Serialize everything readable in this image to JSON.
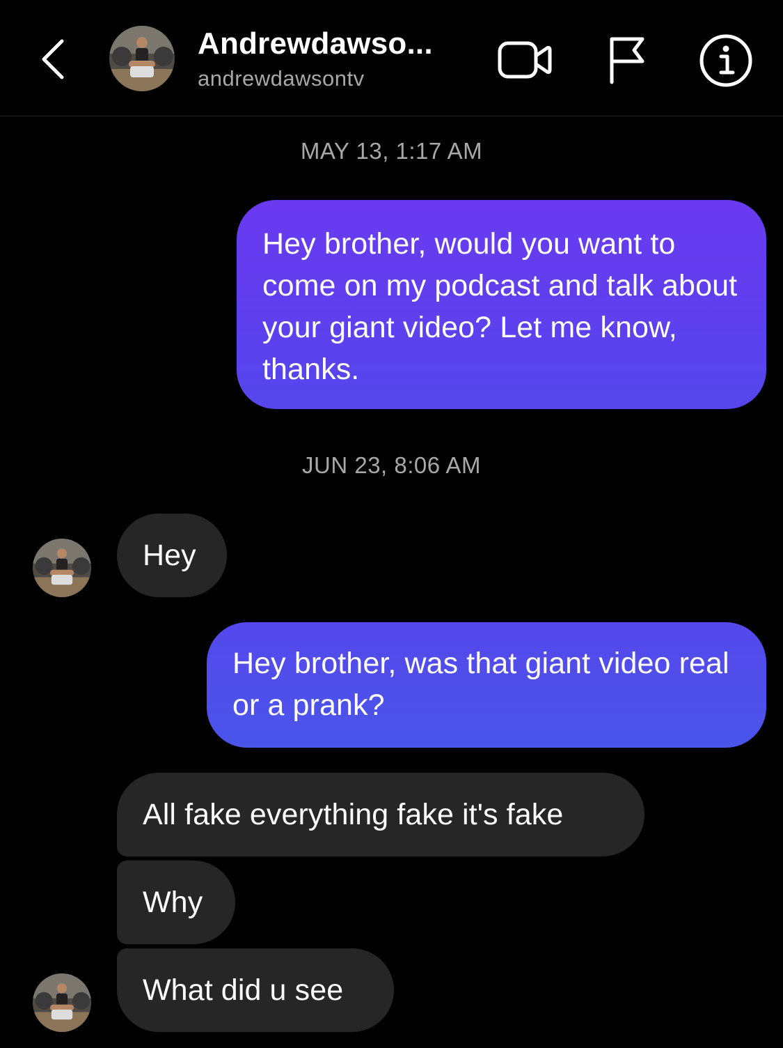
{
  "header": {
    "title": "Andrewdawso...",
    "handle": "andrewdawsontv",
    "icons": {
      "back": "chevron-left-icon",
      "video": "video-camera-icon",
      "flag": "flag-icon",
      "info": "info-icon"
    }
  },
  "messages": {
    "timestamp_1": "MAY 13, 1:17 AM",
    "sent_1": "Hey brother, would you want to come on my podcast and talk about your giant video? Let me know, thanks.",
    "timestamp_2": "JUN 23, 8:06 AM",
    "received_1": "Hey",
    "sent_2": "Hey brother, was that giant video real or a prank?",
    "received_2": "All fake everything fake it's fake",
    "received_3": "Why",
    "received_4": "What did u see"
  },
  "colors": {
    "background": "#000000",
    "sent_bubble_top": "#6a3af0",
    "sent_bubble_bottom": "#4a55ea",
    "received_bubble": "#262626",
    "secondary_text": "#a8a8a8"
  }
}
